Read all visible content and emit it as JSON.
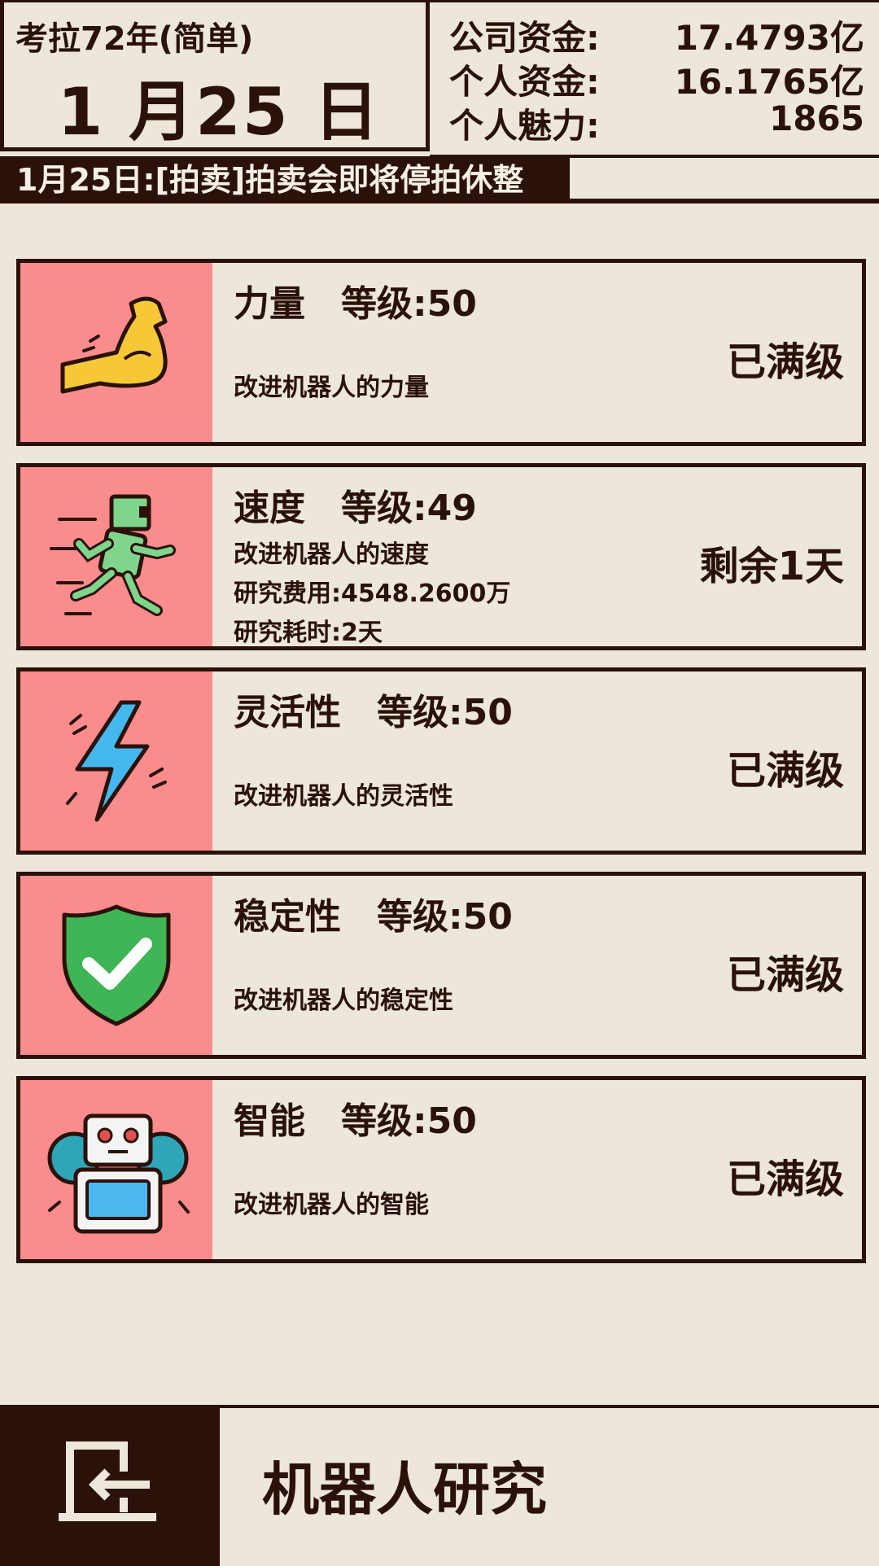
{
  "header": {
    "era": "考拉72年(简单)",
    "date": "1 月25 日",
    "money": [
      {
        "label": "公司资金:",
        "value": "17.4793亿"
      },
      {
        "label": "个人资金:",
        "value": "16.1765亿"
      },
      {
        "label": "个人魅力:",
        "value": "1865"
      }
    ]
  },
  "news": "1月25日:[拍卖]拍卖会即将停拍休整",
  "cards": [
    {
      "title": "力量　等级:50",
      "desc": "改进机器人的力量",
      "status": "已满级",
      "icon": "flexed-bicep-icon"
    },
    {
      "title": "速度　等级:49",
      "desc": "改进机器人的速度",
      "cost": "研究费用:4548.2600万",
      "time": "研究耗时:2天",
      "status": "剩余1天",
      "icon": "running-robot-icon"
    },
    {
      "title": "灵活性　等级:50",
      "desc": "改进机器人的灵活性",
      "status": "已满级",
      "icon": "lightning-icon"
    },
    {
      "title": "稳定性　等级:50",
      "desc": "改进机器人的稳定性",
      "status": "已满级",
      "icon": "shield-check-icon"
    },
    {
      "title": "智能　等级:50",
      "desc": "改进机器人的智能",
      "status": "已满级",
      "icon": "robot-gear-icon"
    }
  ],
  "footer": {
    "title": "机器人研究",
    "back_icon": "exit-door-icon"
  },
  "colors": {
    "dark": "#2a120a",
    "background": "#ede6da",
    "icon_pane": "#fb8c8d"
  }
}
